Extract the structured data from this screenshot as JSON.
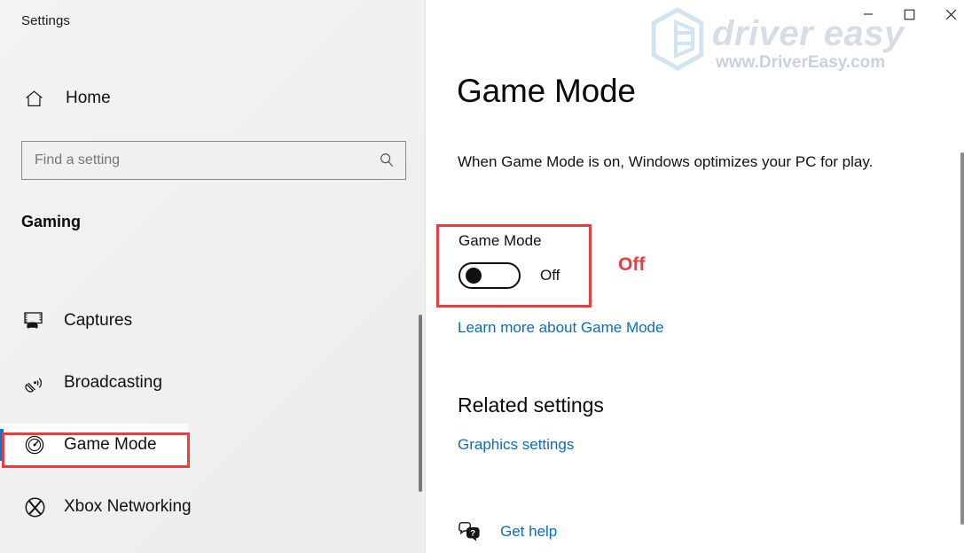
{
  "window": {
    "app_title": "Settings",
    "controls": [
      {
        "name": "minimize",
        "glyph": "minimize-icon"
      },
      {
        "name": "maximize",
        "glyph": "maximize-icon"
      },
      {
        "name": "close",
        "glyph": "close-icon"
      }
    ]
  },
  "watermark": {
    "brand": "driver easy",
    "url": "www.DriverEasy.com",
    "logo_icon": "driver-easy-hex-logo"
  },
  "sidebar": {
    "home": {
      "label": "Home",
      "icon": "home-icon"
    },
    "search": {
      "value": "",
      "placeholder": "Find a setting",
      "icon": "search-icon"
    },
    "section_title": "Gaming",
    "items": [
      {
        "label": "Captures",
        "icon": "captures-icon",
        "selected": false
      },
      {
        "label": "Broadcasting",
        "icon": "broadcasting-icon",
        "selected": false
      },
      {
        "label": "Game Mode",
        "icon": "game-mode-icon",
        "selected": true
      },
      {
        "label": "Xbox Networking",
        "icon": "xbox-icon",
        "selected": false
      }
    ]
  },
  "main": {
    "title": "Game Mode",
    "description": "When Game Mode is on, Windows optimizes your PC for play.",
    "toggle": {
      "label": "Game Mode",
      "state_text": "Off",
      "checked": false
    },
    "learn_more_link": "Learn more about Game Mode",
    "related_settings_title": "Related settings",
    "graphics_settings_link": "Graphics settings",
    "get_help": {
      "label": "Get help",
      "icon": "help-speech-bubble-icon"
    }
  },
  "annotations": {
    "off_callout": "Off",
    "highlight_color": "#ee3b3b"
  },
  "colors": {
    "accent_blue": "#0078d7",
    "link_blue": "#0a6cc3",
    "annotation_red": "#ee3b3b",
    "sidebar_bg": "#f0f0f0"
  }
}
